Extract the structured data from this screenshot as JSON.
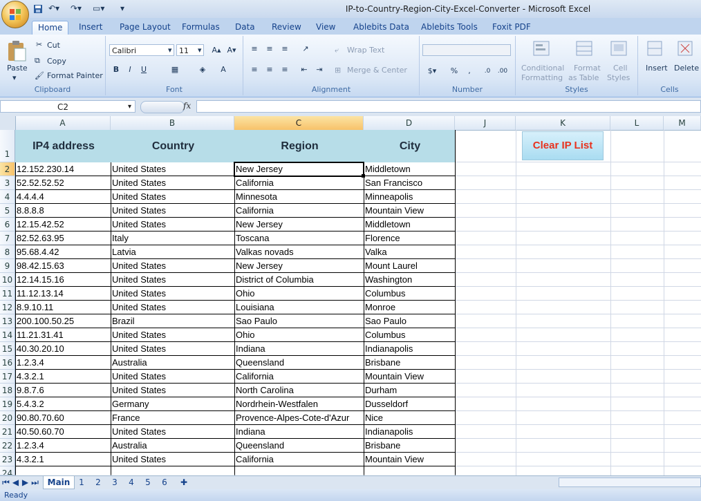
{
  "window": {
    "title": "IP-to-Country-Region-City-Excel-Converter - Microsoft Excel"
  },
  "ribbon_tabs": [
    "Home",
    "Insert",
    "Page Layout",
    "Formulas",
    "Data",
    "Review",
    "View",
    "Ablebits Data",
    "Ablebits Tools",
    "Foxit PDF"
  ],
  "clipboard": {
    "paste": "Paste",
    "cut": "Cut",
    "copy": "Copy",
    "format_painter": "Format Painter",
    "label": "Clipboard"
  },
  "font": {
    "name": "Calibri",
    "size": "11",
    "label": "Font"
  },
  "alignment": {
    "wrap_text": "Wrap Text",
    "merge_center": "Merge & Center",
    "label": "Alignment"
  },
  "number": {
    "label": "Number",
    "percent": "%",
    "comma": ","
  },
  "styles": {
    "conditional": "Conditional",
    "formatting": "Formatting",
    "format_as": "Format",
    "as_table": "as Table",
    "cell": "Cell",
    "cell_styles": "Styles",
    "label": "Styles"
  },
  "cells": {
    "insert": "Insert",
    "delete": "Delete",
    "label": "Cells"
  },
  "formula_bar": {
    "name_box": "C2",
    "fx": "fx",
    "value": ""
  },
  "columns": [
    "A",
    "B",
    "C",
    "D",
    "J",
    "K",
    "L",
    "M"
  ],
  "headers": {
    "ip": "IP4 address",
    "country": "Country",
    "region": "Region",
    "city": "City"
  },
  "button": {
    "clear": "Clear IP List"
  },
  "rows": [
    {
      "n": "2",
      "ip": "12.152.230.14",
      "country": "United States",
      "region": "New Jersey",
      "city": "Middletown"
    },
    {
      "n": "3",
      "ip": "52.52.52.52",
      "country": "United States",
      "region": "California",
      "city": "San Francisco"
    },
    {
      "n": "4",
      "ip": "4.4.4.4",
      "country": "United States",
      "region": "Minnesota",
      "city": "Minneapolis"
    },
    {
      "n": "5",
      "ip": "8.8.8.8",
      "country": "United States",
      "region": "California",
      "city": "Mountain View"
    },
    {
      "n": "6",
      "ip": "12.15.42.52",
      "country": "United States",
      "region": "New Jersey",
      "city": "Middletown"
    },
    {
      "n": "7",
      "ip": "82.52.63.95",
      "country": "Italy",
      "region": "Toscana",
      "city": "Florence"
    },
    {
      "n": "8",
      "ip": "95.68.4.42",
      "country": "Latvia",
      "region": "Valkas novads",
      "city": "Valka"
    },
    {
      "n": "9",
      "ip": "98.42.15.63",
      "country": "United States",
      "region": "New Jersey",
      "city": "Mount Laurel"
    },
    {
      "n": "10",
      "ip": "12.14.15.16",
      "country": "United States",
      "region": "District of Columbia",
      "city": "Washington"
    },
    {
      "n": "11",
      "ip": "11.12.13.14",
      "country": "United States",
      "region": "Ohio",
      "city": "Columbus"
    },
    {
      "n": "12",
      "ip": "8.9.10.11",
      "country": "United States",
      "region": "Louisiana",
      "city": "Monroe"
    },
    {
      "n": "13",
      "ip": "200.100.50.25",
      "country": "Brazil",
      "region": "Sao Paulo",
      "city": "Sao Paulo"
    },
    {
      "n": "14",
      "ip": "11.21.31.41",
      "country": "United States",
      "region": "Ohio",
      "city": "Columbus"
    },
    {
      "n": "15",
      "ip": "40.30.20.10",
      "country": "United States",
      "region": "Indiana",
      "city": "Indianapolis"
    },
    {
      "n": "16",
      "ip": "1.2.3.4",
      "country": "Australia",
      "region": "Queensland",
      "city": "Brisbane"
    },
    {
      "n": "17",
      "ip": "4.3.2.1",
      "country": "United States",
      "region": "California",
      "city": "Mountain View"
    },
    {
      "n": "18",
      "ip": "9.8.7.6",
      "country": "United States",
      "region": "North Carolina",
      "city": "Durham"
    },
    {
      "n": "19",
      "ip": "5.4.3.2",
      "country": "Germany",
      "region": "Nordrhein-Westfalen",
      "city": "Dusseldorf"
    },
    {
      "n": "20",
      "ip": "90.80.70.60",
      "country": "France",
      "region": "Provence-Alpes-Cote-d'Azur",
      "city": "Nice"
    },
    {
      "n": "21",
      "ip": "40.50.60.70",
      "country": "United States",
      "region": "Indiana",
      "city": "Indianapolis"
    },
    {
      "n": "22",
      "ip": "1.2.3.4",
      "country": "Australia",
      "region": "Queensland",
      "city": "Brisbane"
    },
    {
      "n": "23",
      "ip": "4.3.2.1",
      "country": "United States",
      "region": "California",
      "city": "Mountain View"
    }
  ],
  "extra_rows": [
    "1",
    "24"
  ],
  "sheet_tabs": [
    "Main",
    "1",
    "2",
    "3",
    "4",
    "5",
    "6"
  ],
  "status": {
    "text": "Ready"
  }
}
